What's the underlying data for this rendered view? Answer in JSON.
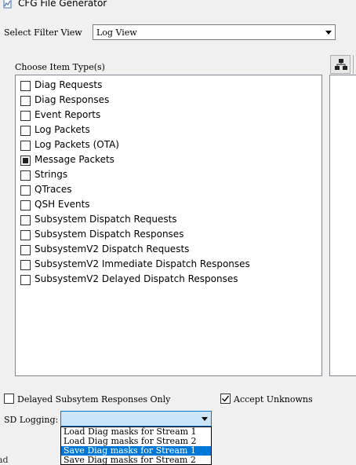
{
  "window": {
    "title": "CFG File Generator",
    "icon": "app-chart-icon"
  },
  "filter": {
    "label": "Select Filter View",
    "value": "Log View"
  },
  "item_type": {
    "label": "Choose Item Type(s)",
    "items": [
      {
        "label": "Diag Requests",
        "checked": false
      },
      {
        "label": "Diag Responses",
        "checked": false
      },
      {
        "label": "Event Reports",
        "checked": false
      },
      {
        "label": "Log Packets",
        "checked": false
      },
      {
        "label": "Log Packets (OTA)",
        "checked": false
      },
      {
        "label": "Message Packets",
        "checked": true
      },
      {
        "label": "Strings",
        "checked": false
      },
      {
        "label": "QTraces",
        "checked": false
      },
      {
        "label": "QSH Events",
        "checked": false
      },
      {
        "label": "Subsystem Dispatch Requests",
        "checked": false
      },
      {
        "label": "Subsystem Dispatch Responses",
        "checked": false
      },
      {
        "label": "SubsystemV2 Dispatch Requests",
        "checked": false
      },
      {
        "label": "SubsystemV2 Immediate Dispatch Responses",
        "checked": false
      },
      {
        "label": "SubsystemV2 Delayed Dispatch Responses",
        "checked": false
      }
    ]
  },
  "right_panel": {
    "tree_button_icon": "tree-hierarchy-icon"
  },
  "options": {
    "delayed_label": "Delayed Subsytem Responses Only",
    "delayed_checked": false,
    "accept_label": "Accept Unknowns",
    "accept_checked": true
  },
  "sd_logging": {
    "label": "SD Logging:",
    "value": "",
    "options": [
      {
        "label": "Load Diag masks for Stream 1",
        "selected": false
      },
      {
        "label": "Load Diag masks for Stream 2",
        "selected": false
      },
      {
        "label": "Save Diag masks for Stream 1",
        "selected": true
      },
      {
        "label": "Save Diag masks for Stream 2",
        "selected": false
      }
    ]
  },
  "background_fragment": "ad",
  "colors": {
    "selection": "#0078d7",
    "select_focus_bg": "#cce4f7",
    "window_bg": "#f0f0f0"
  }
}
